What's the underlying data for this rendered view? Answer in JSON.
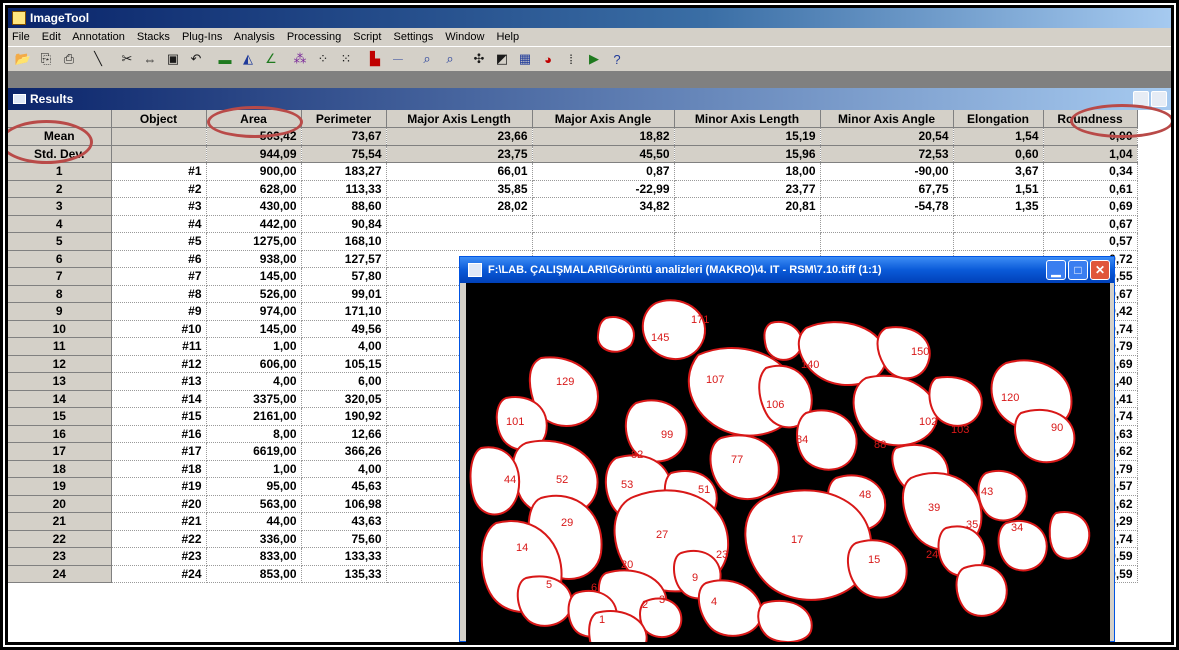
{
  "app": {
    "title": "ImageTool"
  },
  "menu": [
    "File",
    "Edit",
    "Annotation",
    "Stacks",
    "Plug-Ins",
    "Analysis",
    "Processing",
    "Script",
    "Settings",
    "Window",
    "Help"
  ],
  "results": {
    "title": "Results",
    "columns": [
      "Object",
      "Area",
      "Perimeter",
      "Major Axis Length",
      "Major Axis Angle",
      "Minor Axis Length",
      "Minor Axis Angle",
      "Elongation",
      "Roundness"
    ],
    "stats": [
      {
        "label": "Mean",
        "values": [
          "",
          "503,42",
          "73,67",
          "23,66",
          "18,82",
          "15,19",
          "20,54",
          "1,54",
          "0,90"
        ]
      },
      {
        "label": "Std. Dev.",
        "values": [
          "",
          "944,09",
          "75,54",
          "23,75",
          "45,50",
          "15,96",
          "72,53",
          "0,60",
          "1,04"
        ]
      }
    ],
    "rows": [
      {
        "n": "1",
        "obj": "#1",
        "area": "900,00",
        "perim": "183,27",
        "majl": "66,01",
        "maja": "0,87",
        "minl": "18,00",
        "mina": "-90,00",
        "elong": "3,67",
        "round": "0,34"
      },
      {
        "n": "2",
        "obj": "#2",
        "area": "628,00",
        "perim": "113,33",
        "majl": "35,85",
        "maja": "-22,99",
        "minl": "23,77",
        "mina": "67,75",
        "elong": "1,51",
        "round": "0,61"
      },
      {
        "n": "3",
        "obj": "#3",
        "area": "430,00",
        "perim": "88,60",
        "majl": "28,02",
        "maja": "34,82",
        "minl": "20,81",
        "mina": "-54,78",
        "elong": "1,35",
        "round": "0,69"
      },
      {
        "n": "4",
        "obj": "#4",
        "area": "442,00",
        "perim": "90,84",
        "majl": "",
        "maja": "",
        "minl": "",
        "mina": "",
        "elong": "",
        "round": "0,67"
      },
      {
        "n": "5",
        "obj": "#5",
        "area": "1275,00",
        "perim": "168,10",
        "majl": "",
        "maja": "",
        "minl": "",
        "mina": "",
        "elong": "",
        "round": "0,57"
      },
      {
        "n": "6",
        "obj": "#6",
        "area": "938,00",
        "perim": "127,57",
        "majl": "",
        "maja": "",
        "minl": "",
        "mina": "",
        "elong": "",
        "round": "0,72"
      },
      {
        "n": "7",
        "obj": "#7",
        "area": "145,00",
        "perim": "57,80",
        "majl": "",
        "maja": "",
        "minl": "",
        "mina": "",
        "elong": "",
        "round": "0,55"
      },
      {
        "n": "8",
        "obj": "#8",
        "area": "526,00",
        "perim": "99,01",
        "majl": "",
        "maja": "",
        "minl": "",
        "mina": "",
        "elong": "",
        "round": "0,67"
      },
      {
        "n": "9",
        "obj": "#9",
        "area": "974,00",
        "perim": "171,10",
        "majl": "",
        "maja": "",
        "minl": "",
        "mina": "",
        "elong": "",
        "round": "0,42"
      },
      {
        "n": "10",
        "obj": "#10",
        "area": "145,00",
        "perim": "49,56",
        "majl": "",
        "maja": "",
        "minl": "",
        "mina": "",
        "elong": "",
        "round": "0,74"
      },
      {
        "n": "11",
        "obj": "#11",
        "area": "1,00",
        "perim": "4,00",
        "majl": "",
        "maja": "",
        "minl": "",
        "mina": "",
        "elong": "",
        "round": "0,79"
      },
      {
        "n": "12",
        "obj": "#12",
        "area": "606,00",
        "perim": "105,15",
        "majl": "",
        "maja": "",
        "minl": "",
        "mina": "",
        "elong": "",
        "round": "0,69"
      },
      {
        "n": "13",
        "obj": "#13",
        "area": "4,00",
        "perim": "6,00",
        "majl": "",
        "maja": "",
        "minl": "",
        "mina": "",
        "elong": "",
        "round": "1,40"
      },
      {
        "n": "14",
        "obj": "#14",
        "area": "3375,00",
        "perim": "320,05",
        "majl": "",
        "maja": "",
        "minl": "",
        "mina": "",
        "elong": "",
        "round": "0,41"
      },
      {
        "n": "15",
        "obj": "#15",
        "area": "2161,00",
        "perim": "190,92",
        "majl": "",
        "maja": "",
        "minl": "",
        "mina": "",
        "elong": "",
        "round": "0,74"
      },
      {
        "n": "16",
        "obj": "#16",
        "area": "8,00",
        "perim": "12,66",
        "majl": "",
        "maja": "",
        "minl": "",
        "mina": "",
        "elong": "",
        "round": "0,63"
      },
      {
        "n": "17",
        "obj": "#17",
        "area": "6619,00",
        "perim": "366,26",
        "majl": "",
        "maja": "",
        "minl": "",
        "mina": "",
        "elong": "",
        "round": "0,62"
      },
      {
        "n": "18",
        "obj": "#18",
        "area": "1,00",
        "perim": "4,00",
        "majl": "",
        "maja": "",
        "minl": "",
        "mina": "",
        "elong": "",
        "round": "0,79"
      },
      {
        "n": "19",
        "obj": "#19",
        "area": "95,00",
        "perim": "45,63",
        "majl": "",
        "maja": "",
        "minl": "",
        "mina": "",
        "elong": "",
        "round": "0,57"
      },
      {
        "n": "20",
        "obj": "#20",
        "area": "563,00",
        "perim": "106,98",
        "majl": "",
        "maja": "",
        "minl": "",
        "mina": "",
        "elong": "",
        "round": "0,62"
      },
      {
        "n": "21",
        "obj": "#21",
        "area": "44,00",
        "perim": "43,63",
        "majl": "",
        "maja": "",
        "minl": "",
        "mina": "",
        "elong": "",
        "round": "0,29"
      },
      {
        "n": "22",
        "obj": "#22",
        "area": "336,00",
        "perim": "75,60",
        "majl": "",
        "maja": "",
        "minl": "",
        "mina": "",
        "elong": "",
        "round": "0,74"
      },
      {
        "n": "23",
        "obj": "#23",
        "area": "833,00",
        "perim": "133,33",
        "majl": "",
        "maja": "",
        "minl": "",
        "mina": "",
        "elong": "",
        "round": "0,59"
      },
      {
        "n": "24",
        "obj": "#24",
        "area": "853,00",
        "perim": "135,33",
        "majl": "",
        "maja": "",
        "minl": "",
        "mina": "",
        "elong": "",
        "round": "0,59"
      }
    ]
  },
  "image_window": {
    "title": "F:\\LAB. ÇALIŞMALARI\\Görüntü analizleri (MAKRO)\\4. IT - RSM\\7.10.tiff (1:1)",
    "labels": [
      "145",
      "171",
      "107",
      "106",
      "129",
      "140",
      "150",
      "120",
      "101",
      "99",
      "84",
      "88",
      "103",
      "102",
      "90",
      "82",
      "77",
      "52",
      "44",
      "53",
      "51",
      "48",
      "43",
      "39",
      "29",
      "27",
      "17",
      "14",
      "15",
      "35",
      "34",
      "20",
      "23",
      "9",
      "5",
      "6",
      "2",
      "3",
      "4",
      "1",
      "24"
    ]
  },
  "colors": {
    "annotation": "#b94a48",
    "label": "#d81818"
  }
}
